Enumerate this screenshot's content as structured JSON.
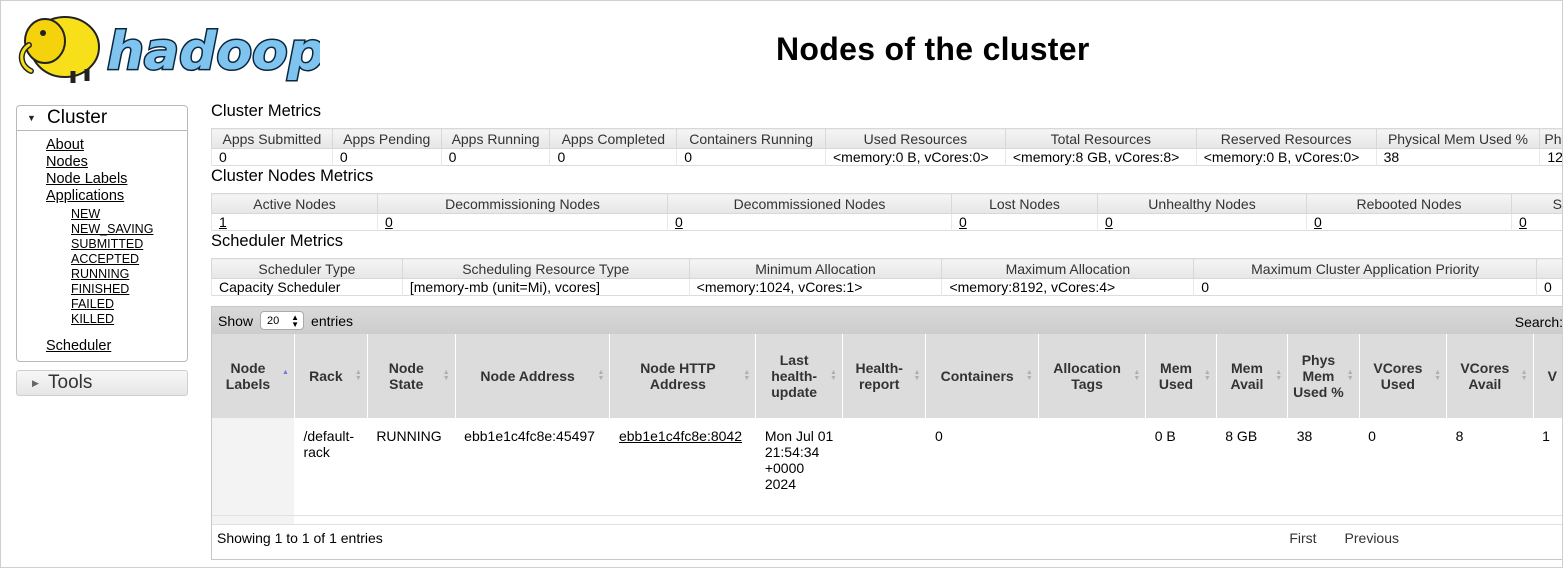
{
  "header": {
    "logo_text": "hadoop",
    "title": "Nodes of the cluster"
  },
  "sidebar": {
    "cluster_label": "Cluster",
    "links": [
      "About",
      "Nodes",
      "Node Labels",
      "Applications"
    ],
    "app_states": [
      "NEW",
      "NEW_SAVING",
      "SUBMITTED",
      "ACCEPTED",
      "RUNNING",
      "FINISHED",
      "FAILED",
      "KILLED"
    ],
    "scheduler_label": "Scheduler",
    "tools_label": "Tools"
  },
  "cluster_metrics": {
    "title": "Cluster Metrics",
    "headers": [
      "Apps Submitted",
      "Apps Pending",
      "Apps Running",
      "Apps Completed",
      "Containers Running",
      "Used Resources",
      "Total Resources",
      "Reserved Resources",
      "Physical Mem Used %",
      "Ph"
    ],
    "values": [
      "0",
      "0",
      "0",
      "0",
      "0",
      "<memory:0 B, vCores:0>",
      "<memory:8 GB, vCores:8>",
      "<memory:0 B, vCores:0>",
      "38",
      "12"
    ]
  },
  "cluster_nodes_metrics": {
    "title": "Cluster Nodes Metrics",
    "headers": [
      "Active Nodes",
      "Decommissioning Nodes",
      "Decommissioned Nodes",
      "Lost Nodes",
      "Unhealthy Nodes",
      "Rebooted Nodes",
      "S"
    ],
    "values": [
      "1",
      "0",
      "0",
      "0",
      "0",
      "0",
      "0"
    ]
  },
  "scheduler_metrics": {
    "title": "Scheduler Metrics",
    "headers": [
      "Scheduler Type",
      "Scheduling Resource Type",
      "Minimum Allocation",
      "Maximum Allocation",
      "Maximum Cluster Application Priority",
      ""
    ],
    "values": [
      "Capacity Scheduler",
      "[memory-mb (unit=Mi), vcores]",
      "<memory:1024, vCores:1>",
      "<memory:8192, vCores:4>",
      "0",
      "0"
    ]
  },
  "nodes_table": {
    "show_label": "Show",
    "entries_label": "entries",
    "page_size": "20",
    "search_label": "Search:",
    "headers": [
      "Node Labels",
      "Rack",
      "Node State",
      "Node Address",
      "Node HTTP Address",
      "Last health-update",
      "Health-report",
      "Containers",
      "Allocation Tags",
      "Mem Used",
      "Mem Avail",
      "Phys Mem Used %",
      "VCores Used",
      "VCores Avail",
      "V"
    ],
    "rows": [
      [
        "",
        "/default-rack",
        "RUNNING",
        "ebb1e1c4fc8e:45497",
        "ebb1e1c4fc8e:8042",
        "Mon Jul 01 21:54:34 +0000 2024",
        "",
        "0",
        "",
        "0 B",
        "8 GB",
        "38",
        "0",
        "8",
        "1"
      ]
    ],
    "footer_info": "Showing 1 to 1 of 1 entries",
    "pager": [
      "First",
      "Previous"
    ]
  }
}
